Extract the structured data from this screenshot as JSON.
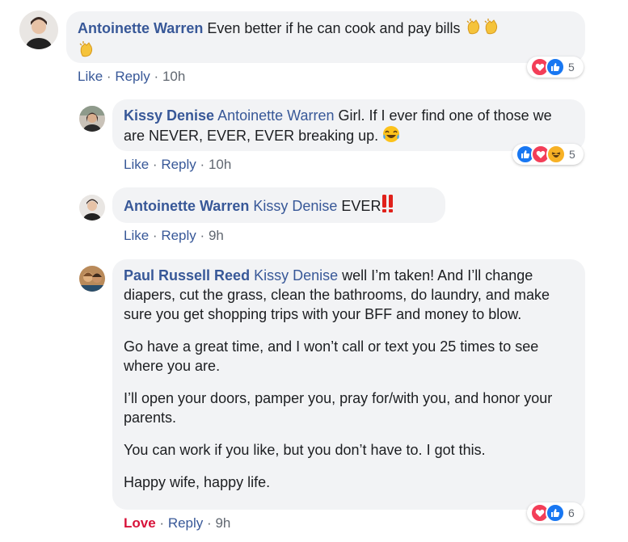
{
  "comments": [
    {
      "author": "Antoinette Warren",
      "text": "Even better if he can cook and pay bills",
      "emoji_after": [
        "clapping-hands-icon",
        "clapping-hands-icon",
        "clapping-hands-icon"
      ],
      "actions": {
        "like": "Like",
        "reply": "Reply",
        "time": "10h",
        "sep": "·"
      },
      "reactions": {
        "icons": [
          "love-icon",
          "like-icon"
        ],
        "count": "5"
      }
    },
    {
      "author": "Kissy Denise",
      "mention": "Antoinette Warren",
      "text": "Girl. If I ever find one of those we are NEVER, EVER, EVER breaking up.",
      "emoji_after": [
        "tears-of-joy-icon"
      ],
      "actions": {
        "like": "Like",
        "reply": "Reply",
        "time": "10h",
        "sep": "·"
      },
      "reactions": {
        "icons": [
          "like-icon",
          "love-icon",
          "haha-icon"
        ],
        "count": "5"
      }
    },
    {
      "author": "Antoinette Warren",
      "mention": "Kissy Denise",
      "text": "EVER",
      "emoji_after": [
        "double-exclamation-icon"
      ],
      "actions": {
        "like": "Like",
        "reply": "Reply",
        "time": "9h",
        "sep": "·"
      }
    },
    {
      "author": "Paul Russell Reed",
      "mention": "Kissy Denise",
      "paragraphs": [
        "well I’m taken! And I’ll change diapers, cut the grass, clean the bathrooms, do laundry, and make sure you get shopping trips with your BFF and money to blow.",
        "Go have a great time, and I won’t call or text you 25 times to see where you are.",
        "I’ll open your doors, pamper you, pray for/with you, and honor your parents.",
        "You can work if you like, but you don’t have to. I got this.",
        "Happy wife, happy life."
      ],
      "actions": {
        "like": "Love",
        "reply": "Reply",
        "time": "9h",
        "sep": "·"
      },
      "reactions": {
        "icons": [
          "love-icon",
          "like-icon"
        ],
        "count": "6"
      }
    }
  ],
  "colors": {
    "name": "#385898",
    "bubble": "#f2f3f5",
    "love": "#d8133a",
    "meta": "#606770",
    "like": "#1877f2"
  }
}
